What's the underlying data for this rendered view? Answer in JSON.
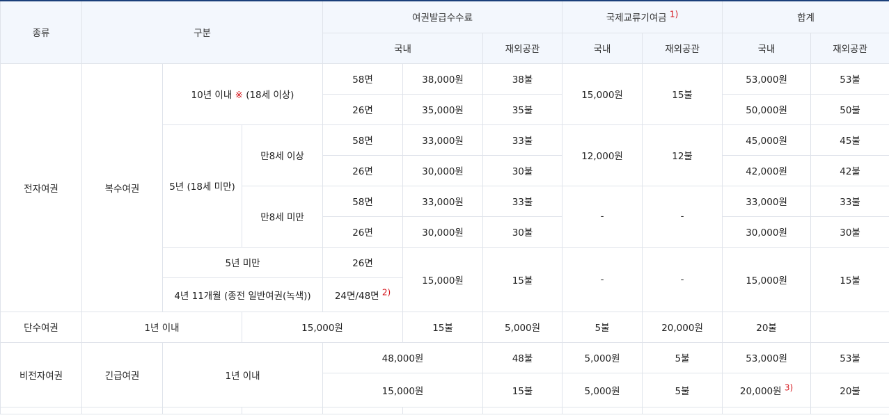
{
  "header": {
    "type": "종류",
    "category": "구분",
    "issuance_fee": "여권발급수수료",
    "intl_fund": "국제교류기여금",
    "intl_fund_note": "1)",
    "total": "합계",
    "domestic": "국내",
    "overseas": "재외공관"
  },
  "rows": {
    "electronic": "전자여권",
    "multi": "복수여권",
    "ten_years": "10년 이내",
    "ten_years_mark": "※",
    "ten_years_age": "(18세 이상)",
    "five_years": "5년 (18세 미만)",
    "age8_over": "만8세 이상",
    "age8_under": "만8세 미만",
    "under5": "5년 미만",
    "old_green": "4년 11개월 (종전 일반여권(녹색))",
    "p58": "58면",
    "p26": "26면",
    "p2448": "24면/48면",
    "p2448_note": "2)",
    "single": "단수여권",
    "one_year": "1년 이내",
    "non_electronic": "비전자여권",
    "emergency": "긴급여권",
    "total_note": "3)",
    "dash": "-"
  },
  "fees": {
    "r1": {
      "dom": "38,000원",
      "ovs": "38불",
      "tdom": "53,000원",
      "tovs": "53불"
    },
    "r2": {
      "dom": "35,000원",
      "ovs": "35불",
      "tdom": "50,000원",
      "tovs": "50불"
    },
    "r3": {
      "dom": "33,000원",
      "ovs": "33불",
      "tdom": "45,000원",
      "tovs": "45불"
    },
    "r4": {
      "dom": "30,000원",
      "ovs": "30불",
      "tdom": "42,000원",
      "tovs": "42불"
    },
    "r5": {
      "dom": "33,000원",
      "ovs": "33불",
      "tdom": "33,000원",
      "tovs": "33불"
    },
    "r6": {
      "dom": "30,000원",
      "ovs": "30불",
      "tdom": "30,000원",
      "tovs": "30불"
    },
    "r7": {
      "dom": "15,000원",
      "ovs": "15불",
      "tdom": "15,000원",
      "tovs": "15불"
    },
    "r9": {
      "dom": "15,000원",
      "ovs": "15불",
      "fdom": "5,000원",
      "fovs": "5불",
      "tdom": "20,000원",
      "tovs": "20불"
    },
    "r10": {
      "dom": "48,000원",
      "ovs": "48불",
      "fdom": "5,000원",
      "fovs": "5불",
      "tdom": "53,000원",
      "tovs": "53불"
    },
    "r11": {
      "dom": "15,000원",
      "ovs": "15불",
      "fdom": "5,000원",
      "fovs": "5불",
      "tdom": "20,000원",
      "tovs": "20불"
    },
    "fund10": {
      "dom": "15,000원",
      "ovs": "15불"
    },
    "fund5": {
      "dom": "12,000원",
      "ovs": "12불"
    }
  }
}
